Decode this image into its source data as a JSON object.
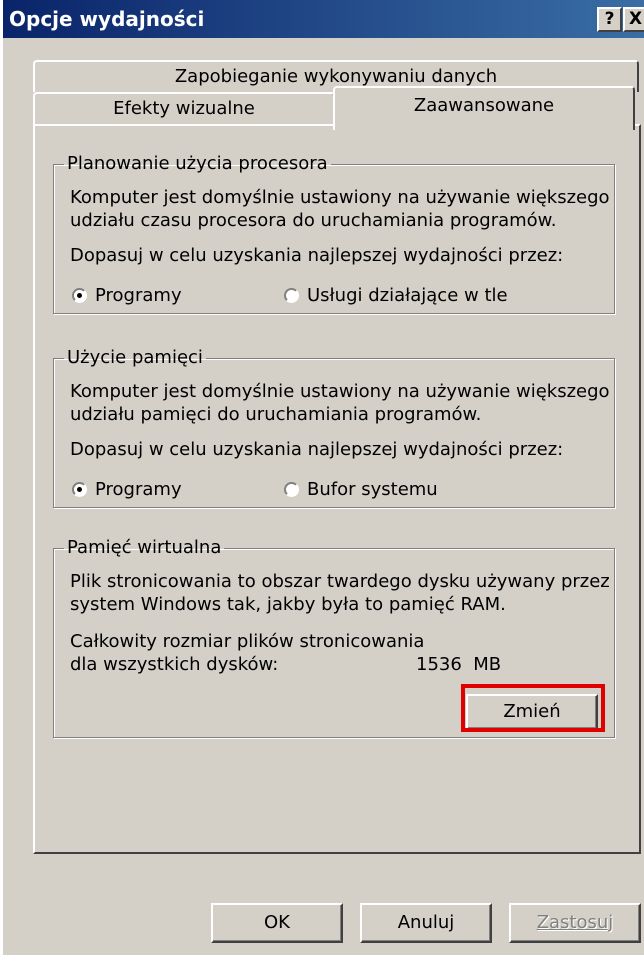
{
  "window": {
    "title": "Opcje wydajności",
    "help_label": "?",
    "close_label": "X"
  },
  "tabs": [
    {
      "label": "Zapobieganie wykonywaniu danych",
      "selected": false
    },
    {
      "label": "Efekty wizualne",
      "selected": false
    },
    {
      "label": "Zaawansowane",
      "selected": true
    }
  ],
  "cpu": {
    "legend": "Planowanie użycia procesora",
    "description_line1": "Komputer jest domyślnie ustawiony na używanie większego",
    "description_line2": "udziału czasu procesora do uruchamiania programów.",
    "adjust_label": "Dopasuj w celu uzyskania najlepszej wydajności przez:",
    "options": [
      {
        "label": "Programy",
        "checked": true
      },
      {
        "label": "Usługi działające w tle",
        "checked": false
      }
    ]
  },
  "memory": {
    "legend": "Użycie pamięci",
    "description_line1": "Komputer jest domyślnie ustawiony na używanie większego",
    "description_line2": "udziału pamięci do uruchamiania programów.",
    "adjust_label": "Dopasuj w celu uzyskania najlepszej wydajności przez:",
    "options": [
      {
        "label": "Programy",
        "checked": true
      },
      {
        "label": "Bufor systemu",
        "checked": false
      }
    ]
  },
  "virtual_memory": {
    "legend": "Pamięć wirtualna",
    "description_line1": "Plik stronicowania to obszar twardego dysku używany przez",
    "description_line2": "system Windows tak, jakby była to pamięć RAM.",
    "total_label_line1": "Całkowity rozmiar plików stronicowania",
    "total_label_line2": "dla wszystkich dysków:",
    "total_value": "1536  MB",
    "change_button": "Zmień"
  },
  "footer": {
    "ok": "OK",
    "cancel": "Anuluj",
    "apply": "Zastosuj"
  },
  "colors": {
    "highlight": "#e00000",
    "title_bar": "#0a246a",
    "dialog_bg": "#d4d0c8"
  }
}
